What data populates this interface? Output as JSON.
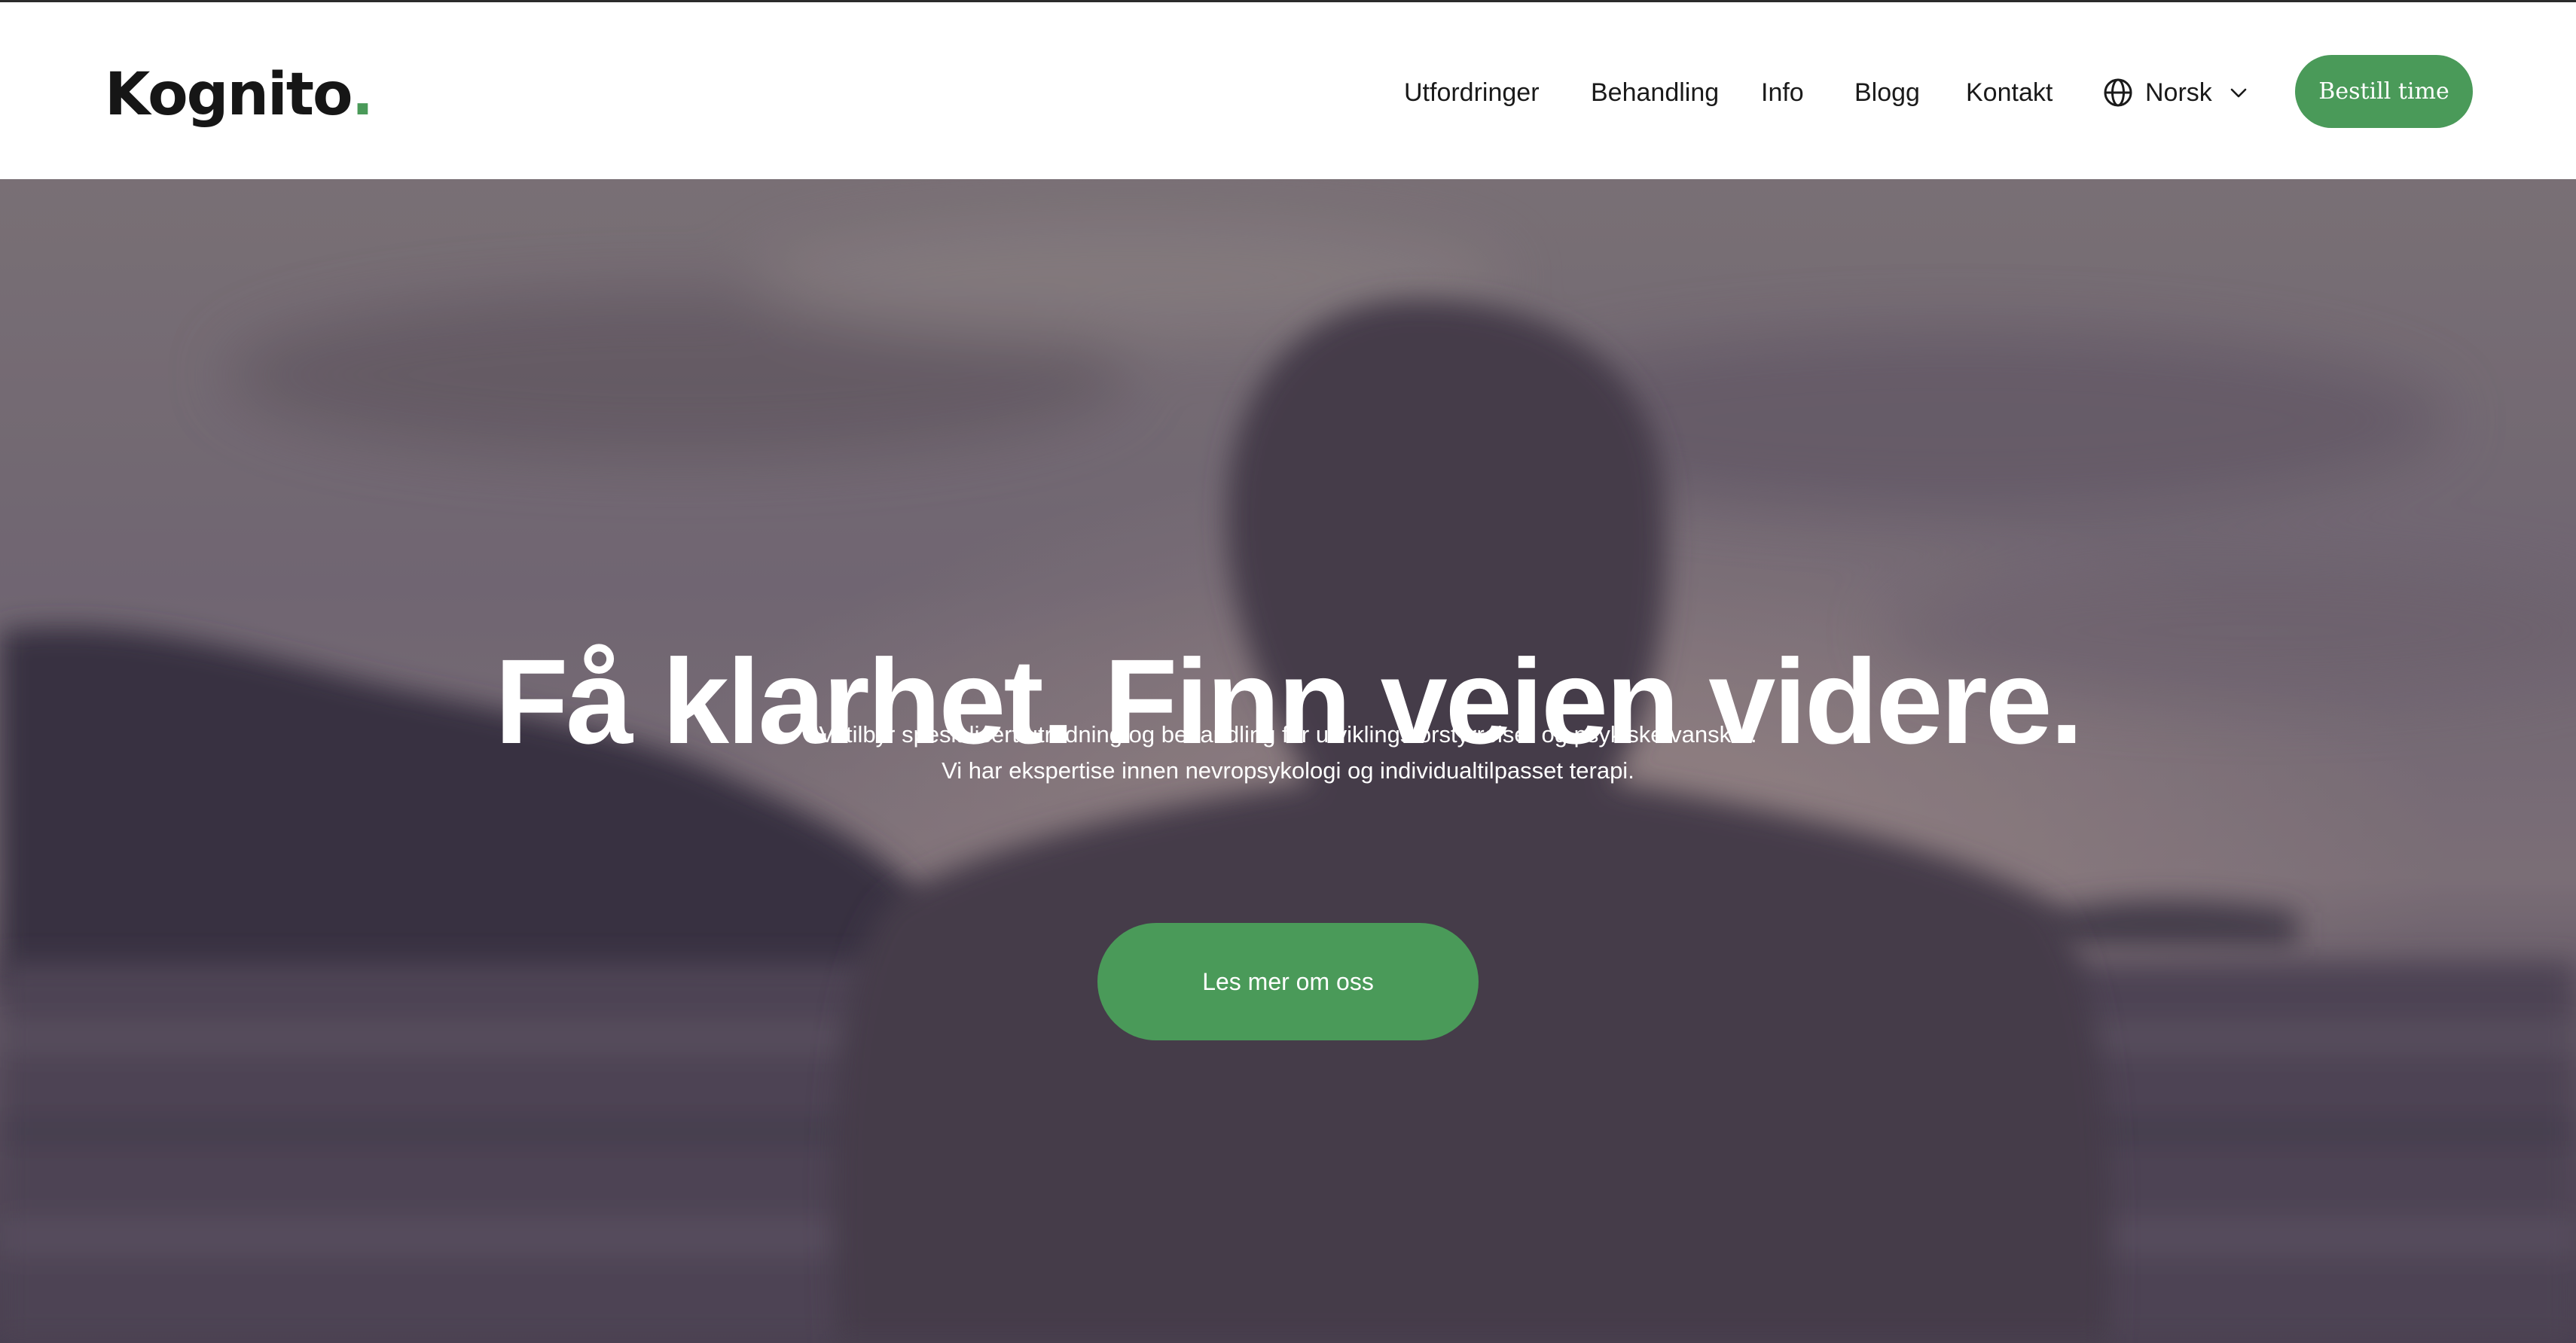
{
  "brand": {
    "name": "Kognito",
    "dot": ".",
    "accent_color": "#4a9a59"
  },
  "nav": {
    "items": [
      {
        "label": "Utfordringer"
      },
      {
        "label": "Behandling"
      },
      {
        "label": "Info"
      },
      {
        "label": "Blogg"
      },
      {
        "label": "Kontakt"
      }
    ],
    "language": {
      "icon": "globe-icon",
      "label": "Norsk",
      "chevron": "chevron-down-icon"
    },
    "cta_label": "Bestill time"
  },
  "hero": {
    "title": "Få klarhet. Finn veien videre.",
    "subtitle_lines": [
      "Vi tilbyr spesialisert utredning og behandling for utviklingsforstyrrelser og psykiske vansker.",
      "Vi har ekspertise innen nevropsykologi og individualtilpasset terapi."
    ],
    "button_label": "Les mer om oss",
    "background": "blurred photo of a person facing the sea at dusk"
  }
}
